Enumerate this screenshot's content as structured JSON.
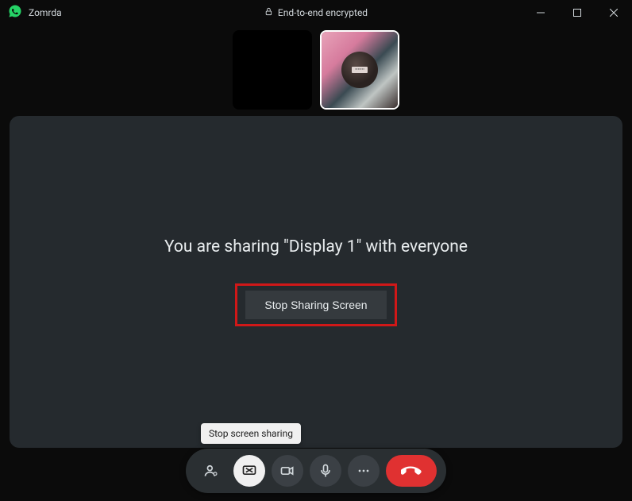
{
  "titlebar": {
    "contact_name": "Zomrda",
    "encryption_label": "End-to-end encrypted"
  },
  "thumbnails": {
    "self_label": "",
    "peer_label": ""
  },
  "main": {
    "sharing_message": "You are sharing \"Display 1\" with everyone",
    "stop_button_label": "Stop Sharing Screen"
  },
  "tooltip": {
    "text": "Stop screen sharing"
  },
  "callbar": {
    "add_participant": "add-participant",
    "screen_share": "screen-share",
    "video": "video",
    "mic": "microphone",
    "more": "more-options",
    "end": "end-call"
  }
}
